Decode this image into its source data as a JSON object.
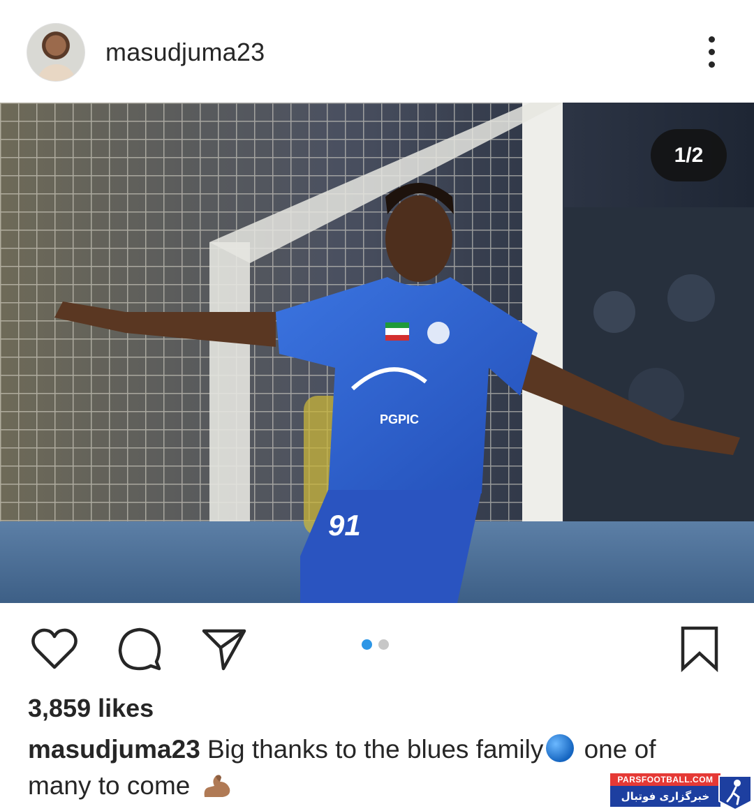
{
  "post": {
    "username": "masudjuma23",
    "slide_counter": "1/2",
    "likes": "3,859 likes",
    "caption": {
      "user": "masudjuma23",
      "text_part1": " Big thanks to the blues family",
      "emoji1": "blue-circle-emoji",
      "text_part2": " one of many to come ",
      "emoji2": "flexed-biceps-emoji"
    },
    "carousel": {
      "total": 2,
      "current": 1
    }
  },
  "photo": {
    "jersey_number": "91",
    "sponsor_text": "PGPIC"
  },
  "watermark": {
    "top": "PARSFOOTBALL.COM",
    "bottom": "خبرگزاری فوتبال ایران"
  },
  "colors": {
    "accent_blue": "#2d96e6",
    "text": "#262626",
    "jersey_blue": "#2f63d3"
  },
  "icons": [
    "more-vertical-icon",
    "heart-icon",
    "comment-icon",
    "share-icon",
    "bookmark-icon"
  ]
}
